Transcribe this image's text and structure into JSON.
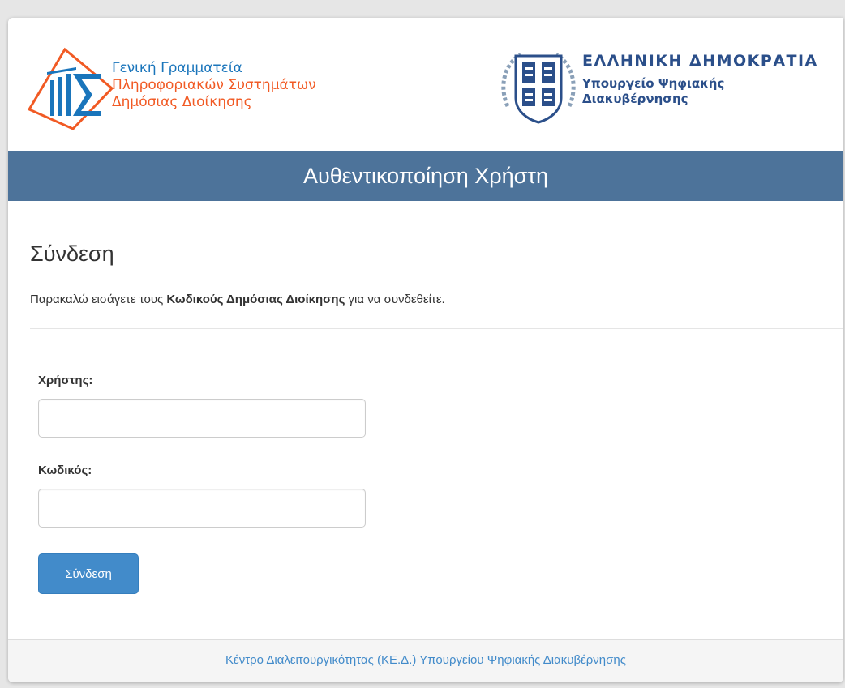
{
  "header": {
    "org_line1": "Γενική Γραμματεία",
    "org_line2": "Πληροφοριακών Συστημάτων",
    "org_line3": "Δημόσιας Διοίκησης",
    "republic_title": "ΕΛΛΗΝΙΚΗ ΔΗΜΟΚΡΑΤΙΑ",
    "ministry_line1": "Υπουργείο Ψηφιακής",
    "ministry_line2": "Διακυβέρνησης"
  },
  "banner": {
    "title": "Αυθεντικοποίηση Χρήστη"
  },
  "login": {
    "heading": "Σύνδεση",
    "instructions_before": "Παρακαλώ εισάγετε τους ",
    "instructions_bold": "Κωδικούς Δημόσιας Διοίκησης",
    "instructions_after": " για να συνδεθείτε.",
    "username_label": "Χρήστης:",
    "username_value": "",
    "password_label": "Κωδικός:",
    "password_value": "",
    "submit_label": "Σύνδεση"
  },
  "footer": {
    "link_text": "Κέντρο Διαλειτουργικότητας (ΚΕ.Δ.) Υπουργείου Ψηφιακής Διακυβέρνησης"
  },
  "colors": {
    "banner": "#4d739a",
    "primary_button": "#428bca",
    "org_blue": "#1a75bb",
    "org_orange": "#f15a24",
    "ministry_blue": "#2b4f8a"
  },
  "icons": {
    "gsis_logo": "gsis-logo-icon",
    "greek_emblem": "greek-emblem-icon"
  }
}
